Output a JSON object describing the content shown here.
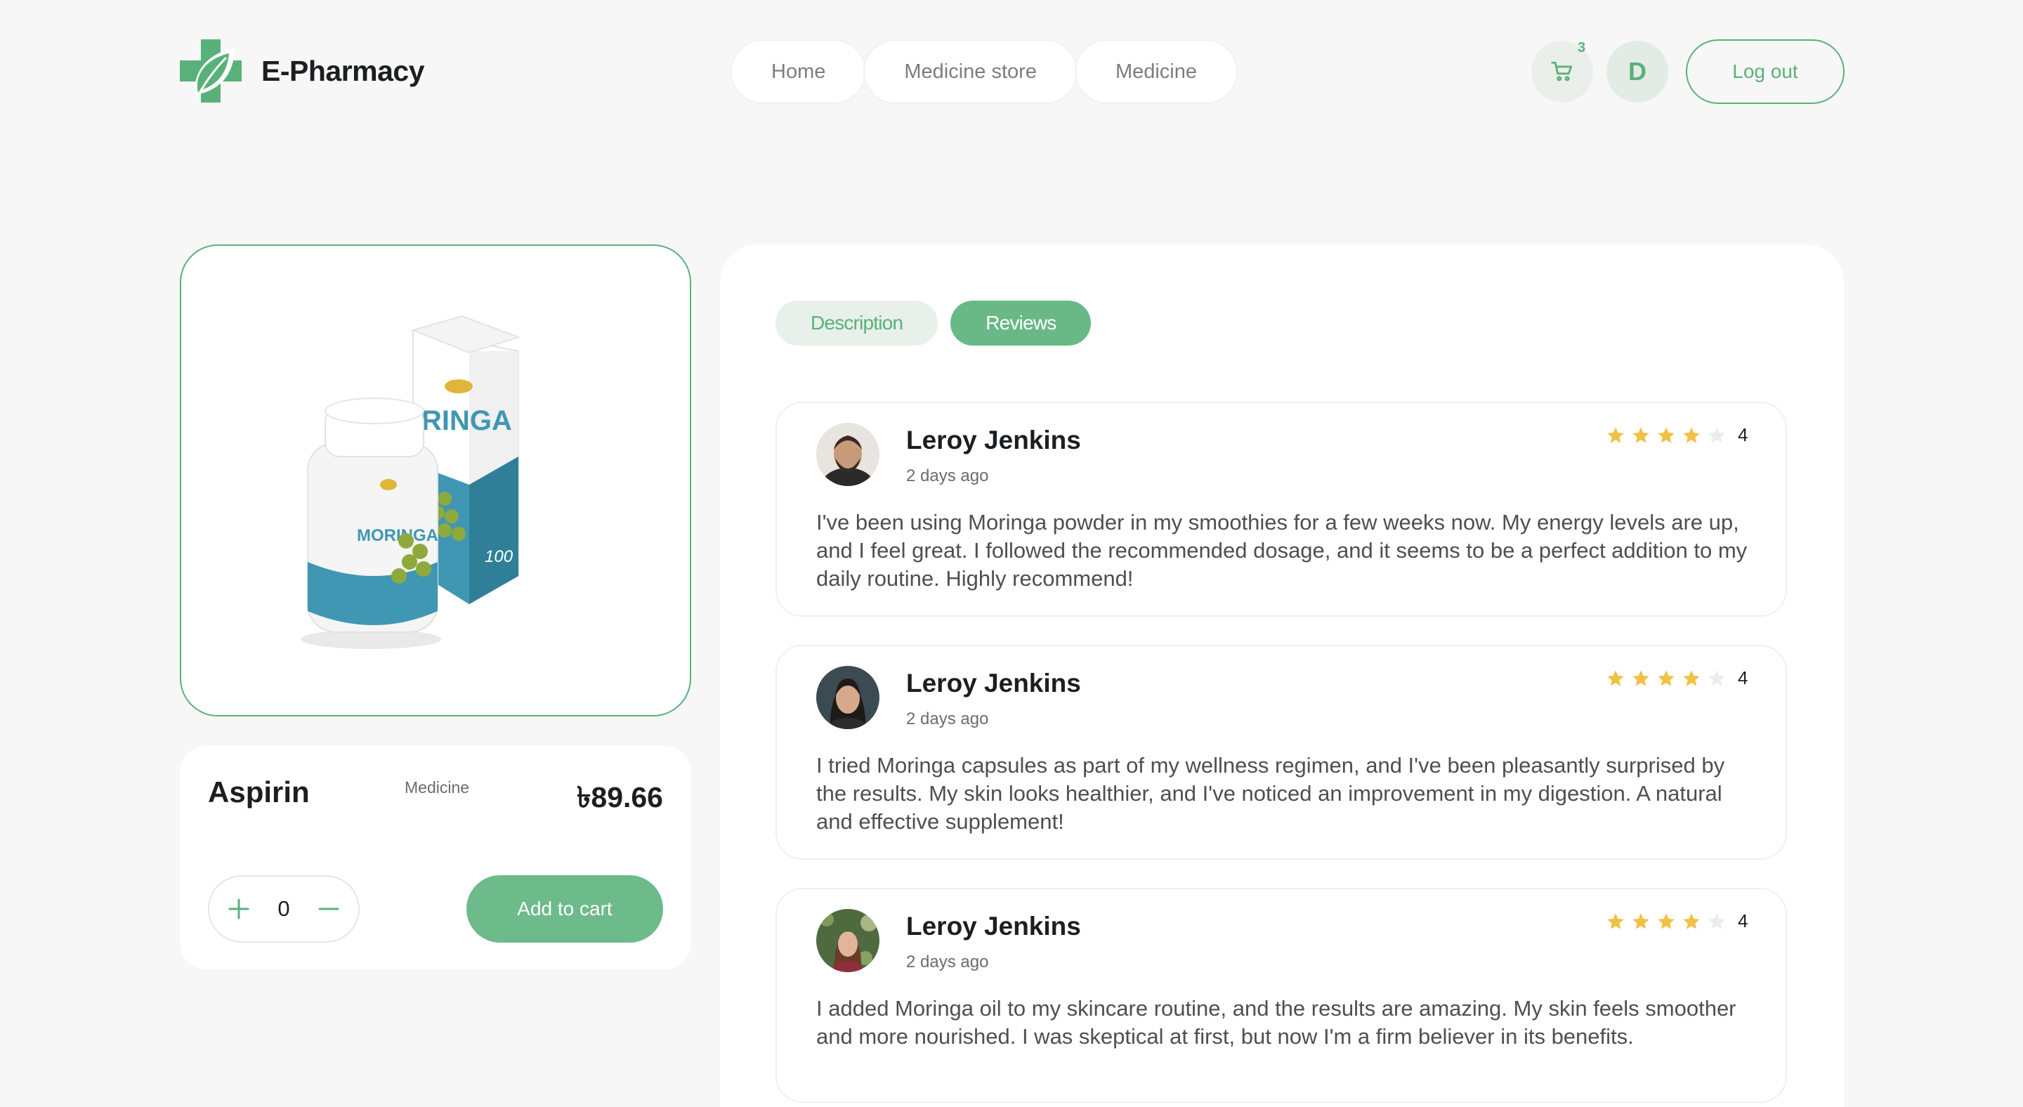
{
  "brand": {
    "name": "E-Pharmacy",
    "icon": "leaf-cross-logo-icon",
    "color": "#59b17a"
  },
  "nav": {
    "items": [
      "Home",
      "Medicine store",
      "Medicine"
    ]
  },
  "header": {
    "cart_count": "3",
    "user_initial": "D",
    "logout_label": "Log out",
    "cart_icon": "cart-icon"
  },
  "product": {
    "name": "Aspirin",
    "category": "Medicine",
    "price": "৳89.66",
    "quantity": "0",
    "add_to_cart_label": "Add to cart",
    "image": "moringa-capsules-product-image"
  },
  "tabs": {
    "description": "Description",
    "reviews": "Reviews",
    "active": "Reviews"
  },
  "reviews": [
    {
      "name": "Leroy Jenkins",
      "date": "2 days ago",
      "rating": "4",
      "stars_filled": 4,
      "text": "I've been using Moringa powder in my smoothies for a few weeks now. My energy levels are up, and I feel great. I followed the recommended dosage, and it seems to be a perfect addition to my daily routine. Highly recommend!"
    },
    {
      "name": "Leroy Jenkins",
      "date": "2 days ago",
      "rating": "4",
      "stars_filled": 4,
      "text": "I tried Moringa capsules as part of my wellness regimen, and I've been pleasantly surprised by the results. My skin looks healthier, and I've noticed an improvement in my digestion. A natural and effective supplement!"
    },
    {
      "name": "Leroy Jenkins",
      "date": "2 days ago",
      "rating": "4",
      "stars_filled": 4,
      "text": "I added Moringa oil to my skincare routine, and the results are amazing. My skin feels smoother and more nourished. I was skeptical at first, but now I'm a firm believer in its benefits."
    }
  ],
  "colors": {
    "accent": "#59b17a",
    "star": "#f1c142",
    "background": "#f7f7f7"
  }
}
